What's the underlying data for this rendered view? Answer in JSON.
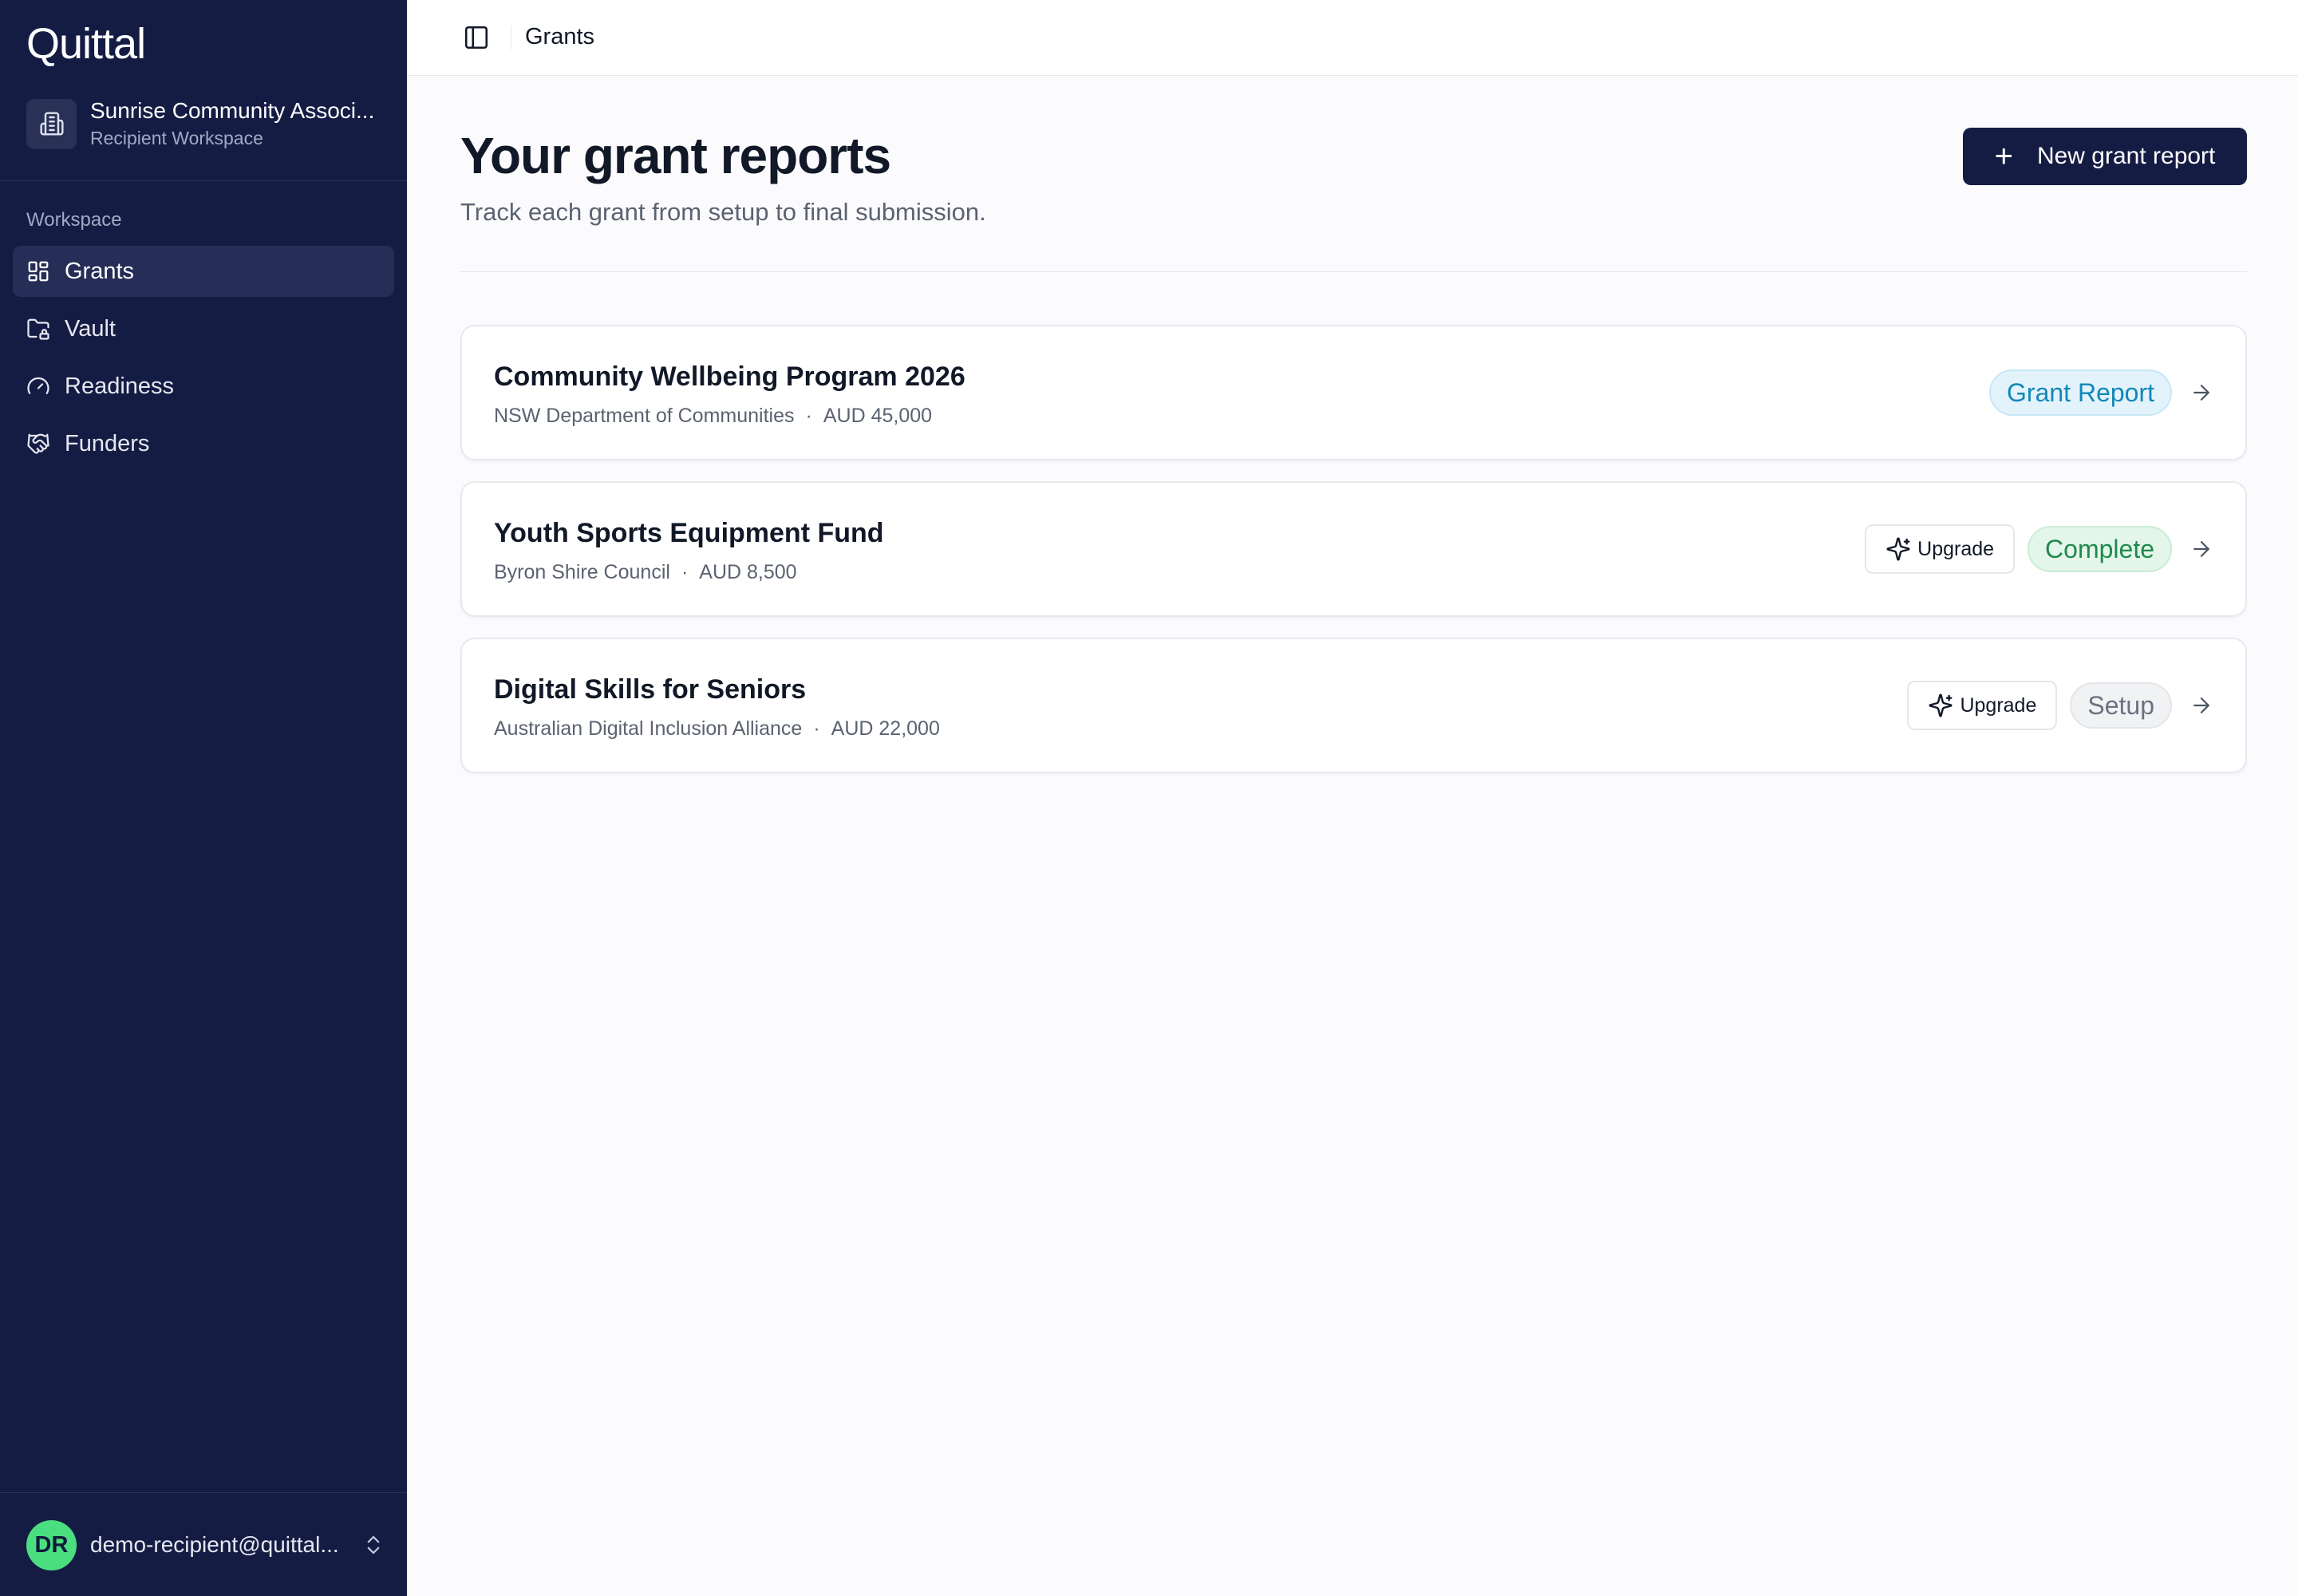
{
  "app": {
    "logo_text": "Quittal",
    "org_name": "Sunrise Community Associ...",
    "org_sub": "Recipient Workspace",
    "section_label": "Workspace"
  },
  "sidebar": {
    "items": [
      {
        "label": "Grants",
        "icon": "grid-icon",
        "active": true
      },
      {
        "label": "Vault",
        "icon": "folder-lock-icon",
        "active": false
      },
      {
        "label": "Readiness",
        "icon": "gauge-icon",
        "active": false
      },
      {
        "label": "Funders",
        "icon": "handshake-icon",
        "active": false
      }
    ]
  },
  "user": {
    "initials": "DR",
    "email": "demo-recipient@quittal..."
  },
  "topbar": {
    "breadcrumb": "Grants"
  },
  "main": {
    "title": "Your grant reports",
    "subtitle": "Track each grant from setup to final submission.",
    "new_button_label": "New grant report"
  },
  "grants": [
    {
      "title": "Community Wellbeing Program 2026",
      "funder": "NSW Department of Communities",
      "amount": "AUD 45,000",
      "status": "Grant Report",
      "upgrade": ""
    },
    {
      "title": "Youth Sports Equipment Fund",
      "funder": "Byron Shire Council",
      "amount": "AUD 8,500",
      "status": "Complete",
      "upgrade": "Upgrade"
    },
    {
      "title": "Digital Skills for Seniors",
      "funder": "Australian Digital Inclusion Alliance",
      "amount": "AUD 22,000",
      "status": "Setup",
      "upgrade": "Upgrade"
    }
  ],
  "colors": {
    "sidebar_bg": "#151c44",
    "accent_green": "#4ade80",
    "status_blue": "#1387b8",
    "status_green": "#1f8a4c",
    "status_grey": "#6b7280"
  }
}
